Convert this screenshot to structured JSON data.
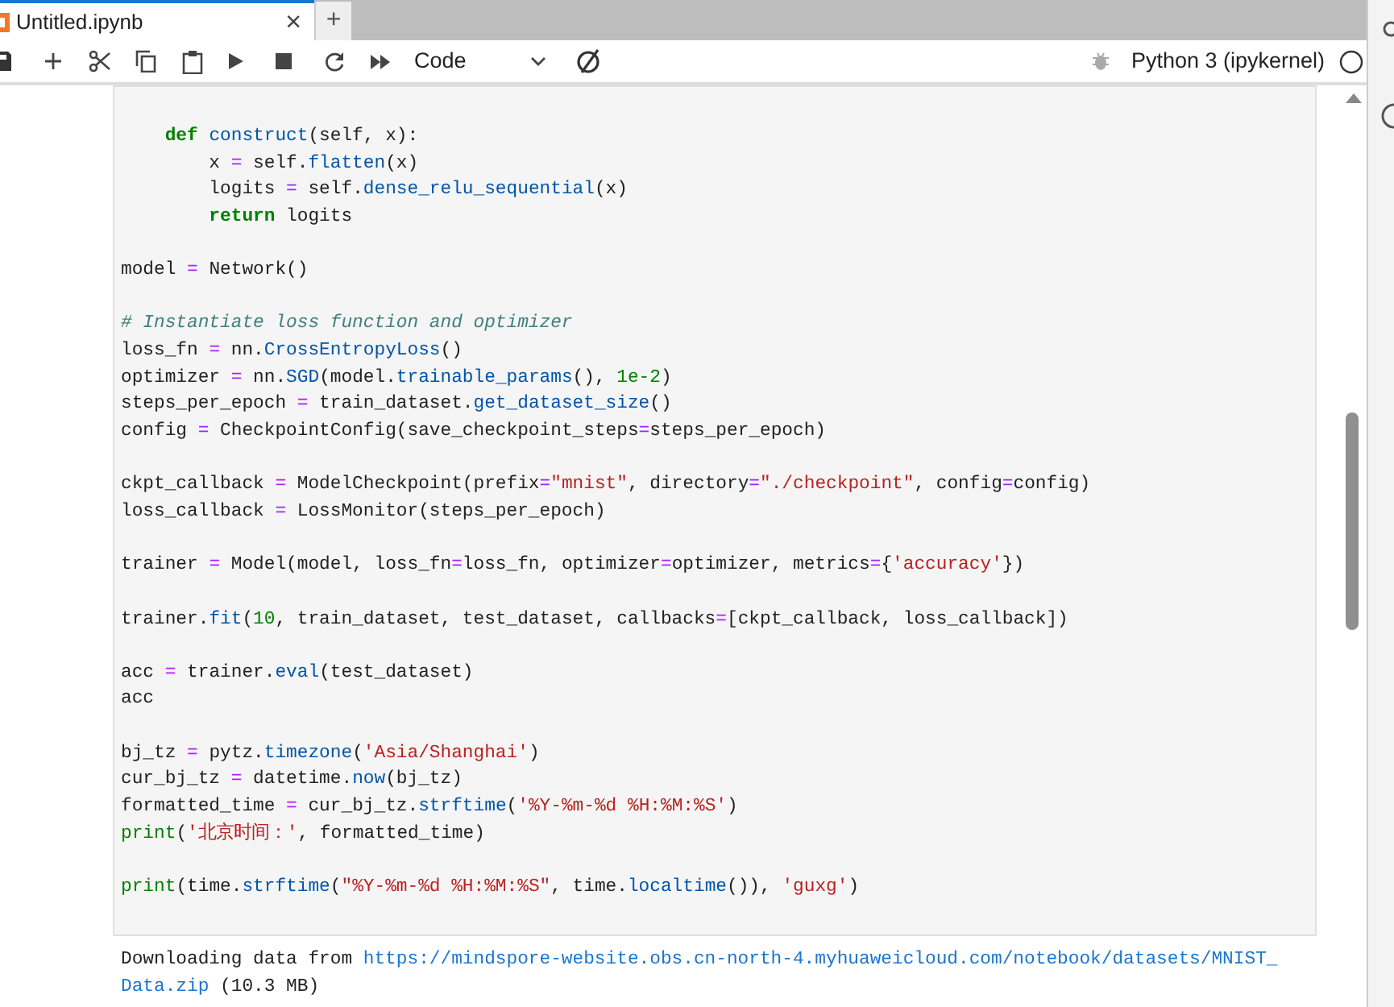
{
  "tab": {
    "title": "Untitled.ipynb",
    "close": "×",
    "new_tab": "+",
    "selected": true
  },
  "toolbar": {
    "cell_type": "Code",
    "kernel": "Python 3 (ipykernel)",
    "kernel_busy": false
  },
  "cell": {
    "blocks": [
      [
        [
          {
            "kind": "kw",
            "text": "    def"
          },
          {
            "kind": "fn",
            "text": " construct"
          },
          {
            "kind": "p",
            "text": "(self, x):"
          }
        ],
        [
          {
            "kind": "p",
            "text": "        x "
          },
          {
            "kind": "op",
            "text": "="
          },
          {
            "kind": "p",
            "text": " self."
          },
          {
            "kind": "fn",
            "text": "flatten"
          },
          {
            "kind": "p",
            "text": "(x)"
          }
        ],
        [
          {
            "kind": "p",
            "text": "        logits "
          },
          {
            "kind": "op",
            "text": "="
          },
          {
            "kind": "p",
            "text": " self."
          },
          {
            "kind": "fn",
            "text": "dense_relu_sequential"
          },
          {
            "kind": "p",
            "text": "(x)"
          }
        ],
        [
          {
            "kind": "kw",
            "text": "        return"
          },
          {
            "kind": "p",
            "text": " logits"
          }
        ]
      ],
      [
        [
          {
            "kind": "p",
            "text": "model "
          },
          {
            "kind": "op",
            "text": "="
          },
          {
            "kind": "p",
            "text": " Network()"
          }
        ]
      ],
      [
        [
          {
            "kind": "cm",
            "text": "# Instantiate loss function and optimizer"
          }
        ],
        [
          {
            "kind": "p",
            "text": "loss_fn "
          },
          {
            "kind": "op",
            "text": "="
          },
          {
            "kind": "p",
            "text": " nn."
          },
          {
            "kind": "fn",
            "text": "CrossEntropyLoss"
          },
          {
            "kind": "p",
            "text": "()"
          }
        ],
        [
          {
            "kind": "p",
            "text": "optimizer "
          },
          {
            "kind": "op",
            "text": "="
          },
          {
            "kind": "p",
            "text": " nn."
          },
          {
            "kind": "fn",
            "text": "SGD"
          },
          {
            "kind": "p",
            "text": "(model."
          },
          {
            "kind": "fn",
            "text": "trainable_params"
          },
          {
            "kind": "p",
            "text": "(), "
          },
          {
            "kind": "num",
            "text": "1e-2"
          },
          {
            "kind": "p",
            "text": ")"
          }
        ],
        [
          {
            "kind": "p",
            "text": "steps_per_epoch "
          },
          {
            "kind": "op",
            "text": "="
          },
          {
            "kind": "p",
            "text": " train_dataset."
          },
          {
            "kind": "fn",
            "text": "get_dataset_size"
          },
          {
            "kind": "p",
            "text": "()"
          }
        ],
        [
          {
            "kind": "p",
            "text": "config "
          },
          {
            "kind": "op",
            "text": "="
          },
          {
            "kind": "p",
            "text": " CheckpointConfig(save_checkpoint_steps"
          },
          {
            "kind": "op",
            "text": "="
          },
          {
            "kind": "p",
            "text": "steps_per_epoch)"
          }
        ]
      ],
      [
        [
          {
            "kind": "p",
            "text": "ckpt_callback "
          },
          {
            "kind": "op",
            "text": "="
          },
          {
            "kind": "p",
            "text": " ModelCheckpoint(prefix"
          },
          {
            "kind": "op",
            "text": "="
          },
          {
            "kind": "str",
            "text": "\"mnist\""
          },
          {
            "kind": "p",
            "text": ", directory"
          },
          {
            "kind": "op",
            "text": "="
          },
          {
            "kind": "str",
            "text": "\"./checkpoint\""
          },
          {
            "kind": "p",
            "text": ", config"
          },
          {
            "kind": "op",
            "text": "="
          },
          {
            "kind": "p",
            "text": "config)"
          }
        ],
        [
          {
            "kind": "p",
            "text": "loss_callback "
          },
          {
            "kind": "op",
            "text": "="
          },
          {
            "kind": "p",
            "text": " LossMonitor(steps_per_epoch)"
          }
        ]
      ],
      [
        [
          {
            "kind": "p",
            "text": "trainer "
          },
          {
            "kind": "op",
            "text": "="
          },
          {
            "kind": "p",
            "text": " Model(model, loss_fn"
          },
          {
            "kind": "op",
            "text": "="
          },
          {
            "kind": "p",
            "text": "loss_fn, optimizer"
          },
          {
            "kind": "op",
            "text": "="
          },
          {
            "kind": "p",
            "text": "optimizer, metrics"
          },
          {
            "kind": "op",
            "text": "="
          },
          {
            "kind": "p",
            "text": "{"
          },
          {
            "kind": "str",
            "text": "'accuracy'"
          },
          {
            "kind": "p",
            "text": "})"
          }
        ]
      ],
      [
        [
          {
            "kind": "p",
            "text": "trainer."
          },
          {
            "kind": "fn",
            "text": "fit"
          },
          {
            "kind": "p",
            "text": "("
          },
          {
            "kind": "num",
            "text": "10"
          },
          {
            "kind": "p",
            "text": ", train_dataset, test_dataset, callbacks"
          },
          {
            "kind": "op",
            "text": "="
          },
          {
            "kind": "p",
            "text": "[ckpt_callback, loss_callback])"
          }
        ]
      ],
      [
        [
          {
            "kind": "p",
            "text": "acc "
          },
          {
            "kind": "op",
            "text": "="
          },
          {
            "kind": "p",
            "text": " trainer."
          },
          {
            "kind": "fn",
            "text": "eval"
          },
          {
            "kind": "p",
            "text": "(test_dataset)"
          }
        ],
        [
          {
            "kind": "p",
            "text": "acc"
          }
        ]
      ],
      [
        [
          {
            "kind": "p",
            "text": "bj_tz "
          },
          {
            "kind": "op",
            "text": "="
          },
          {
            "kind": "p",
            "text": " pytz."
          },
          {
            "kind": "fn",
            "text": "timezone"
          },
          {
            "kind": "p",
            "text": "("
          },
          {
            "kind": "str",
            "text": "'Asia/Shanghai'"
          },
          {
            "kind": "p",
            "text": ")"
          }
        ],
        [
          {
            "kind": "p",
            "text": "cur_bj_tz "
          },
          {
            "kind": "op",
            "text": "="
          },
          {
            "kind": "p",
            "text": " datetime."
          },
          {
            "kind": "fn",
            "text": "now"
          },
          {
            "kind": "p",
            "text": "(bj_tz)"
          }
        ],
        [
          {
            "kind": "p",
            "text": "formatted_time "
          },
          {
            "kind": "op",
            "text": "="
          },
          {
            "kind": "p",
            "text": " cur_bj_tz."
          },
          {
            "kind": "fn",
            "text": "strftime"
          },
          {
            "kind": "p",
            "text": "("
          },
          {
            "kind": "str",
            "text": "'%Y-%m-%d %H:%M:%S'"
          },
          {
            "kind": "p",
            "text": ")"
          }
        ],
        [
          {
            "kind": "bi",
            "text": "print"
          },
          {
            "kind": "p",
            "text": "("
          },
          {
            "kind": "str",
            "text": "'北京时间：'"
          },
          {
            "kind": "p",
            "text": ", formatted_time)"
          }
        ]
      ],
      [
        [
          {
            "kind": "bi",
            "text": "print"
          },
          {
            "kind": "p",
            "text": "(time."
          },
          {
            "kind": "fn",
            "text": "strftime"
          },
          {
            "kind": "p",
            "text": "("
          },
          {
            "kind": "str",
            "text": "\"%Y-%m-%d %H:%M:%S\""
          },
          {
            "kind": "p",
            "text": ", time."
          },
          {
            "kind": "fn",
            "text": "localtime"
          },
          {
            "kind": "p",
            "text": "()), "
          },
          {
            "kind": "str",
            "text": "'guxg'"
          },
          {
            "kind": "p",
            "text": ")"
          }
        ]
      ]
    ]
  },
  "output": [
    [
      {
        "kind": "p",
        "text": "Downloading data from "
      },
      {
        "kind": "link",
        "text": "https://mindspore-website.obs.cn-north-4.myhuaweicloud.com/notebook/datasets/MNIST_"
      }
    ],
    [
      {
        "kind": "link",
        "text": "Data.zip"
      },
      {
        "kind": "p",
        "text": " (10.3 MB)"
      }
    ]
  ]
}
